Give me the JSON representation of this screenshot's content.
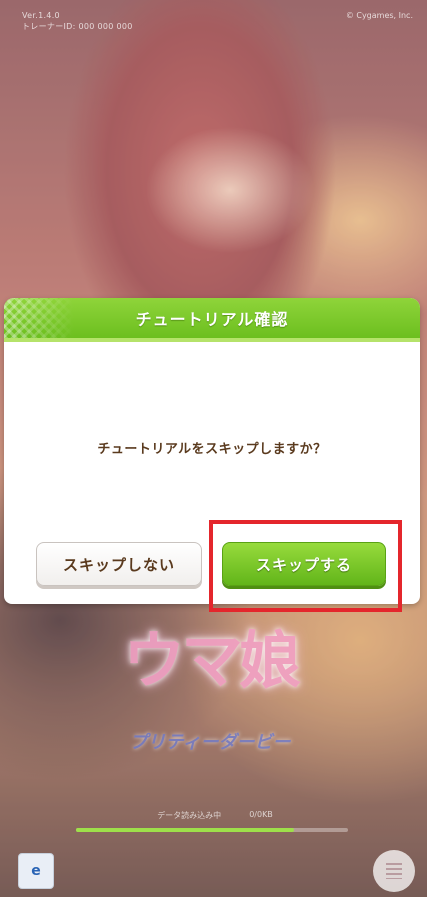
{
  "status": {
    "version": "Ver.1.4.0",
    "trainer_id": "トレーナーID: 000 000 000",
    "copyright": "© Cygames, Inc."
  },
  "dialog": {
    "title": "チュートリアル確認",
    "message": "チュートリアルをスキップしますか？",
    "buttons": {
      "no_skip": "スキップしない",
      "skip": "スキップする"
    }
  },
  "background": {
    "logo_text": "ウマ娘",
    "logo_subtitle": "プリティーダービー",
    "loading_left": "データ読み込み中",
    "loading_right": "0/0KB",
    "progress_fraction": 0.8
  },
  "colors": {
    "accent_green": "#6cbf1f",
    "text_brown": "#5a3a1e",
    "highlight_red": "#e4262c"
  }
}
